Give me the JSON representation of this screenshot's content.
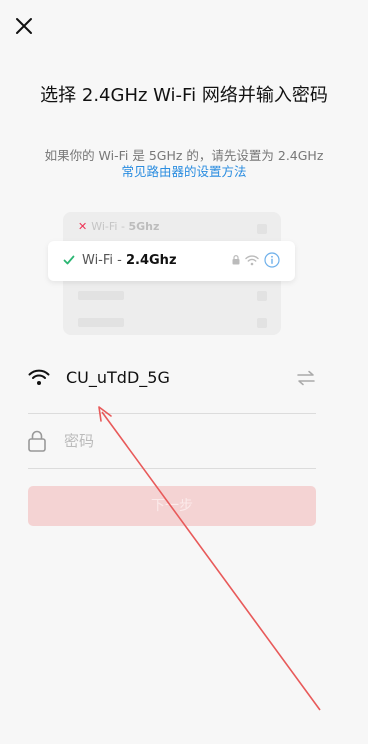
{
  "header": {
    "close_icon": "close-icon"
  },
  "title": "选择 2.4GHz Wi-Fi 网络并输入密码",
  "hint": "如果你的 Wi-Fi 是 5GHz 的，请先设置为 2.4GHz",
  "help_link": "常见路由器的设置方法",
  "illustration": {
    "row_bad": {
      "prefix": "Wi-Fi - ",
      "band": "5Ghz",
      "status_icon": "x-icon"
    },
    "row_good": {
      "prefix": "Wi-Fi - ",
      "band": "2.4Ghz",
      "status_icon": "check-icon"
    }
  },
  "wifi": {
    "ssid": "CU_uTdD_5G",
    "icon": "wifi-icon",
    "switch_icon": "swap-icon"
  },
  "password": {
    "placeholder": "密码",
    "value": "",
    "icon": "lock-icon"
  },
  "next_button": "下一步",
  "colors": {
    "accent_link": "#2b8de0",
    "button_disabled": "#f4d3d3",
    "annotation_arrow": "#e85a5a"
  }
}
